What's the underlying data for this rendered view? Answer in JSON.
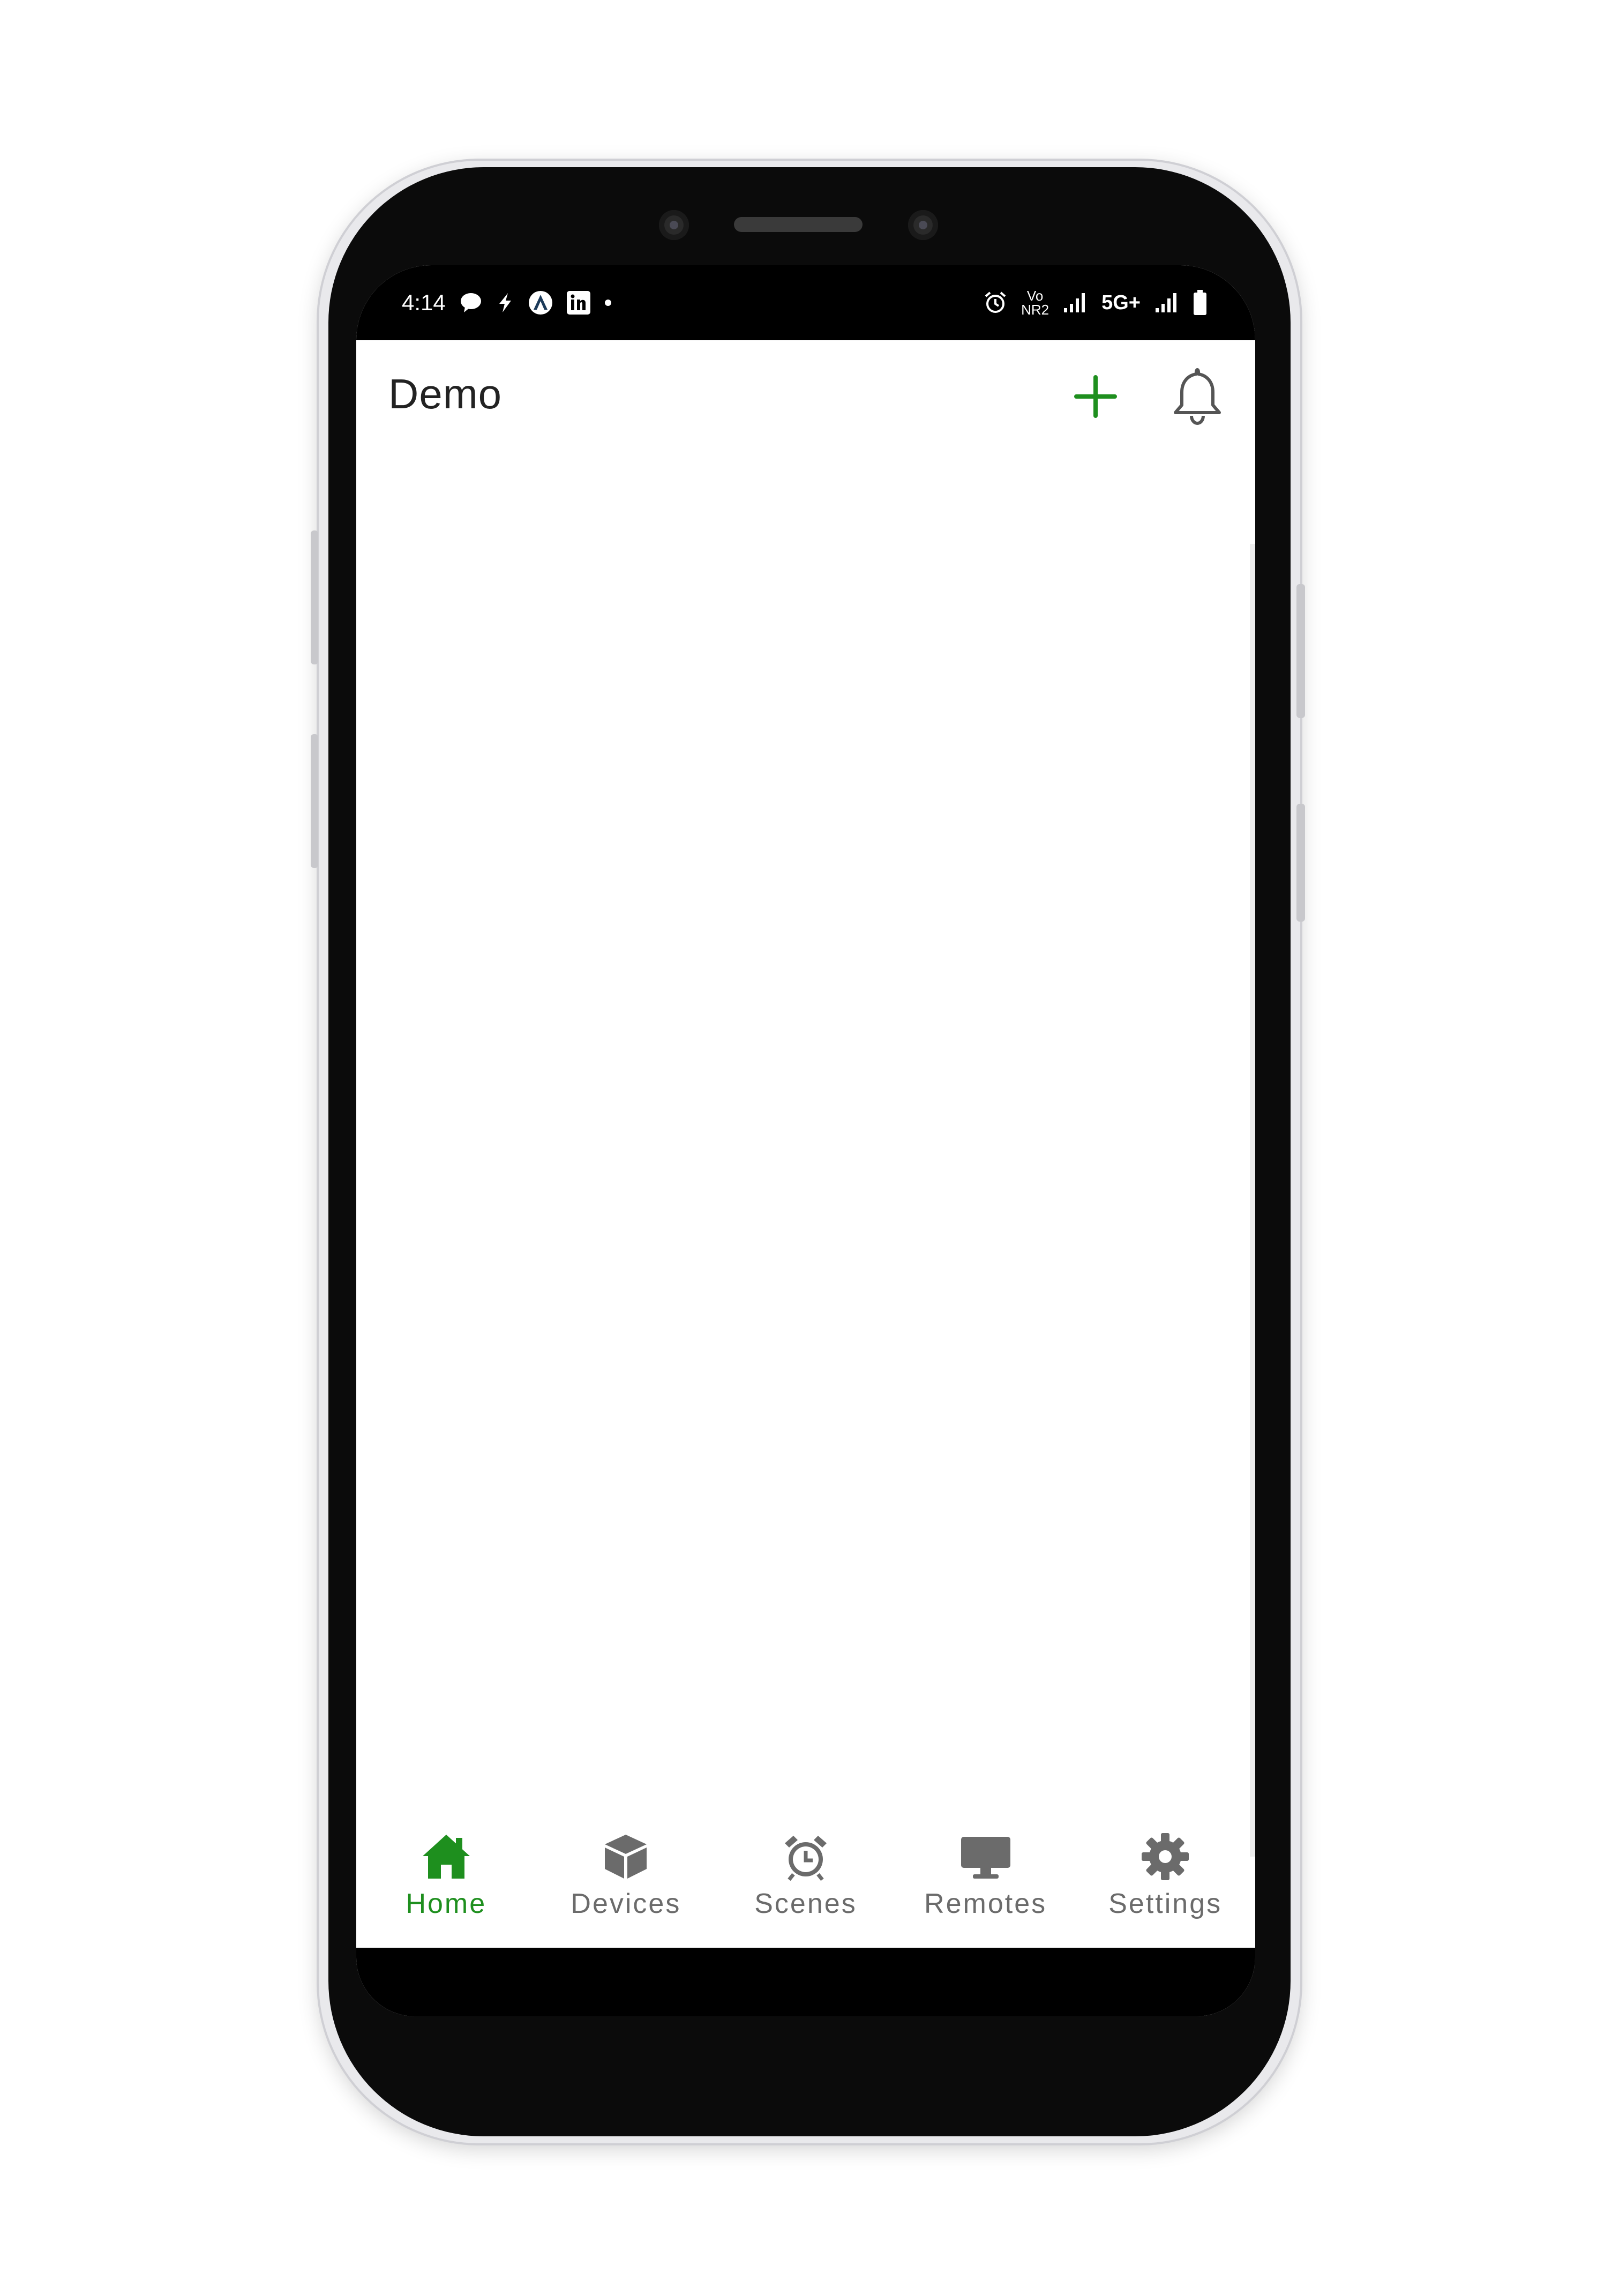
{
  "status_bar": {
    "time": "4:14",
    "left_icons": [
      "chat-bubble-icon",
      "lightning-icon",
      "arc-logo-icon",
      "linkedin-icon",
      "notification-dot-icon"
    ],
    "right_icons": [
      "alarm-icon",
      "vo-nr-icon",
      "signal-icon",
      "5g-icon",
      "signal-icon",
      "battery-icon"
    ],
    "vo_nr_top": "Vo",
    "vo_nr_bottom": "NR2",
    "network": "5G+"
  },
  "app_bar": {
    "title": "Demo",
    "add_icon": "plus-icon",
    "notification_icon": "bell-icon"
  },
  "bottom_nav": {
    "items": [
      {
        "label": "Home",
        "icon": "home-icon",
        "active": true
      },
      {
        "label": "Devices",
        "icon": "cube-icon",
        "active": false
      },
      {
        "label": "Scenes",
        "icon": "alarm-clock-icon",
        "active": false
      },
      {
        "label": "Remotes",
        "icon": "monitor-icon",
        "active": false
      },
      {
        "label": "Settings",
        "icon": "gear-icon",
        "active": false
      }
    ]
  },
  "colors": {
    "accent": "#1e8f1e",
    "inactive": "#6b6b6b",
    "text": "#222222",
    "status_bar": "#000000"
  }
}
